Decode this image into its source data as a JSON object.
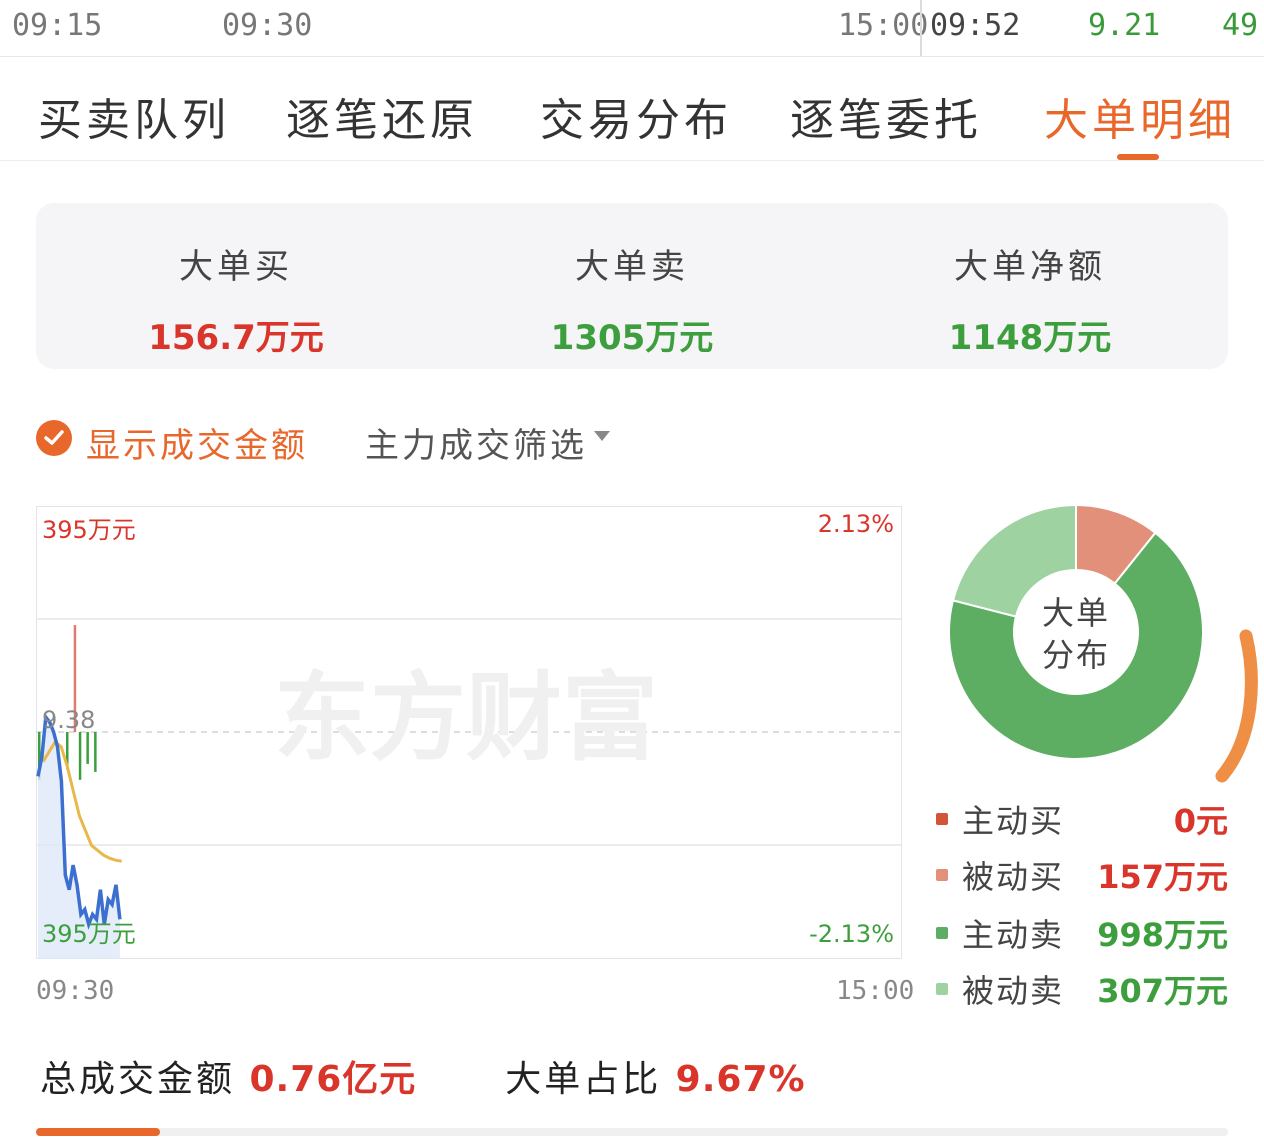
{
  "top_bar": {
    "time_start": "09:15",
    "time_open": "09:30",
    "time_close": "15:00",
    "tick_time": "09:52",
    "tick_price": "9.21",
    "tick_volume": "49"
  },
  "tabs": [
    {
      "label": "买卖队列",
      "active": false
    },
    {
      "label": "逐笔还原",
      "active": false
    },
    {
      "label": "交易分布",
      "active": false
    },
    {
      "label": "逐笔委托",
      "active": false
    },
    {
      "label": "大单明细",
      "active": true
    }
  ],
  "summary": {
    "buy": {
      "label": "大单买",
      "value": "156.7万元"
    },
    "sell": {
      "label": "大单卖",
      "value": "1305万元"
    },
    "net": {
      "label": "大单净额",
      "value": "1148万元"
    }
  },
  "filters": {
    "show_amount_label": "显示成交金额",
    "show_amount_checked": true,
    "main_filter_label": "主力成交筛选"
  },
  "chart": {
    "watermark": "东方财富",
    "top_left_label": "395万元",
    "bottom_left_label": "395万元",
    "top_right_label": "2.13%",
    "bottom_right_label": "-2.13%",
    "mid_price_label": "9.38",
    "x_start_label": "09:30",
    "x_end_label": "15:00"
  },
  "chart_data": {
    "type": "line",
    "x_range": [
      "09:30",
      "15:00"
    ],
    "price_axis": {
      "mid": 9.38,
      "pct_range": [
        -2.13,
        2.13
      ]
    },
    "amount_axis": {
      "max": "395万元"
    },
    "series": [
      {
        "color": "#3b6fd0",
        "values_pct": [
          -0.45,
          -0.25,
          0.15,
          0.1,
          0.0,
          -0.15,
          -0.5,
          -1.45,
          -1.6,
          -1.35,
          -1.55,
          -1.85,
          -1.8,
          -1.95,
          -1.85,
          -1.9,
          -1.6,
          -1.95,
          -1.7,
          -1.75,
          -1.55,
          -1.9
        ]
      },
      {
        "color": "#e8b84a",
        "values_pct": [
          -0.3,
          -0.2,
          -0.1,
          -0.15,
          -0.35,
          -0.6,
          -0.85,
          -1.0,
          -1.15,
          -1.2,
          -1.25,
          -1.28,
          -1.3,
          -1.31
        ]
      }
    ],
    "bars_wan": [
      {
        "t": 0,
        "value": -90,
        "color": "green"
      },
      {
        "t": 11,
        "value": -70,
        "color": "green"
      },
      {
        "t": 14,
        "value": 201,
        "color": "red"
      },
      {
        "t": 16,
        "value": -90,
        "color": "green"
      },
      {
        "t": 19,
        "value": -60,
        "color": "green"
      },
      {
        "t": 22,
        "value": -75,
        "color": "green"
      }
    ]
  },
  "distribution": {
    "center_line1": "大单",
    "center_line2": "分布",
    "items": [
      {
        "label": "主动买",
        "value": "0元",
        "amount": 0,
        "color": "#d2553a"
      },
      {
        "label": "被动买",
        "value": "157万元",
        "amount": 157,
        "color": "#e3907a"
      },
      {
        "label": "主动卖",
        "value": "998万元",
        "amount": 998,
        "color": "#5dae62"
      },
      {
        "label": "被动卖",
        "value": "307万元",
        "amount": 307,
        "color": "#9ed3a1"
      }
    ]
  },
  "footer": {
    "total_label": "总成交金额",
    "total_value": "0.76亿元",
    "ratio_label": "大单占比",
    "ratio_value": "9.67%"
  }
}
